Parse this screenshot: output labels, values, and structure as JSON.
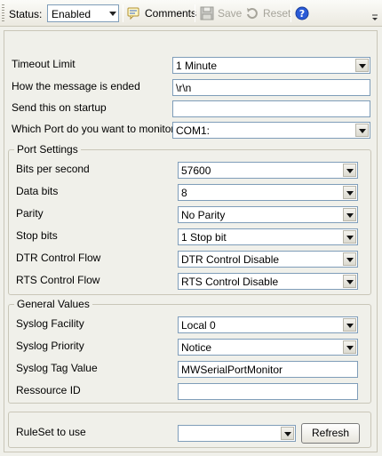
{
  "toolbar": {
    "status_label": "Status:",
    "status_value": "Enabled",
    "comments_label": "Comments",
    "save_label": "Save",
    "reset_label": "Reset"
  },
  "form": {
    "timeout_limit": {
      "label": "Timeout Limit",
      "value": "1 Minute"
    },
    "message_end": {
      "label": "How the message is ended",
      "value": "\\r\\n"
    },
    "startup_send": {
      "label": "Send this on startup",
      "value": ""
    },
    "port_monitor": {
      "label": "Which Port do you want to monitor",
      "value": "COM1:"
    }
  },
  "port_settings": {
    "title": "Port Settings",
    "bits_per_second": {
      "label": "Bits per second",
      "value": "57600"
    },
    "data_bits": {
      "label": "Data bits",
      "value": "8"
    },
    "parity": {
      "label": "Parity",
      "value": "No Parity"
    },
    "stop_bits": {
      "label": "Stop bits",
      "value": "1 Stop bit"
    },
    "dtr": {
      "label": "DTR Control Flow",
      "value": "DTR Control Disable"
    },
    "rts": {
      "label": "RTS Control Flow",
      "value": "RTS Control Disable"
    }
  },
  "general_values": {
    "title": "General Values",
    "facility": {
      "label": "Syslog Facility",
      "value": "Local 0"
    },
    "priority": {
      "label": "Syslog Priority",
      "value": "Notice"
    },
    "tag": {
      "label": "Syslog Tag Value",
      "value": "MWSerialPortMonitor"
    },
    "resource_id": {
      "label": "Ressource ID",
      "value": ""
    }
  },
  "ruleset": {
    "label": "RuleSet to use",
    "value": "",
    "refresh_label": "Refresh"
  },
  "icons": {
    "comments": "comments-icon",
    "save": "save-icon",
    "reset": "reset-icon",
    "help": "help-icon"
  },
  "colors": {
    "window_bg": "#f0f0ea",
    "input_border": "#7f9db9",
    "help_blue": "#2a5bd7"
  }
}
